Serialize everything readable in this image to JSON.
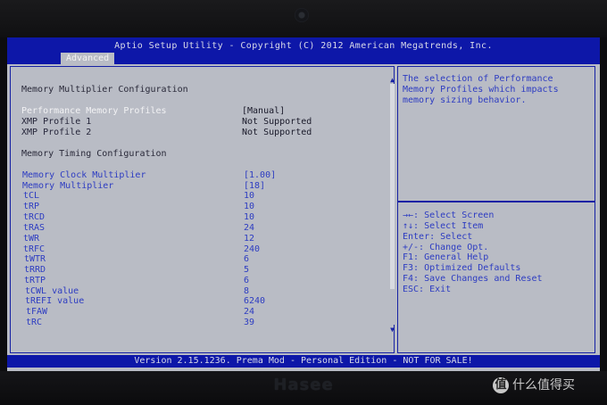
{
  "window": {
    "title": "Aptio Setup Utility - Copyright (C) 2012 American Megatrends, Inc.",
    "active_tab": "Advanced"
  },
  "main": {
    "section1_header": "Memory Multiplier Configuration",
    "profile_rows": [
      {
        "label": "Performance Memory Profiles",
        "value": "[Manual]"
      },
      {
        "label": "XMP Profile 1",
        "value": "Not Supported"
      },
      {
        "label": "XMP Profile 2",
        "value": "Not Supported"
      }
    ],
    "section2_header": "Memory Timing Configuration",
    "timing_rows": [
      {
        "label": "Memory Clock Multiplier",
        "value": "[1.00]"
      },
      {
        "label": "Memory Multiplier",
        "value": "[18]"
      },
      {
        "label": "tCL",
        "value": "10"
      },
      {
        "label": "tRP",
        "value": "10"
      },
      {
        "label": "tRCD",
        "value": "10"
      },
      {
        "label": "tRAS",
        "value": "24"
      },
      {
        "label": "tWR",
        "value": "12"
      },
      {
        "label": "tRFC",
        "value": "240"
      },
      {
        "label": "tWTR",
        "value": "6"
      },
      {
        "label": "tRRD",
        "value": "5"
      },
      {
        "label": "tRTP",
        "value": "6"
      },
      {
        "label": "tCWL value",
        "value": "8"
      },
      {
        "label": "tREFI value",
        "value": "6240"
      },
      {
        "label": "tFAW",
        "value": "24"
      },
      {
        "label": "tRC",
        "value": "39"
      }
    ]
  },
  "help": {
    "description_lines": [
      "The selection of Performance",
      "Memory Profiles which impacts",
      "memory sizing behavior."
    ],
    "keys": [
      "→←: Select Screen",
      "↑↓: Select Item",
      "Enter: Select",
      "+/-: Change Opt.",
      "F1: General Help",
      "F3: Optimized Defaults",
      "F4: Save Changes and Reset",
      "ESC: Exit"
    ]
  },
  "status_bar": "Version 2.15.1236. Prema Mod - Personal Edition - NOT FOR SALE!",
  "bezel_brand": "Hasee",
  "watermark": "什么值得买",
  "watermark_logo": "值",
  "icons": {
    "scroll_up": "▲",
    "scroll_down": "▼"
  },
  "colors": {
    "bios_blue": "#0d17a8",
    "panel_gray": "#b9bcc5",
    "highlight_text": "#2d3cc2",
    "selected_text": "#f2f2f4"
  }
}
